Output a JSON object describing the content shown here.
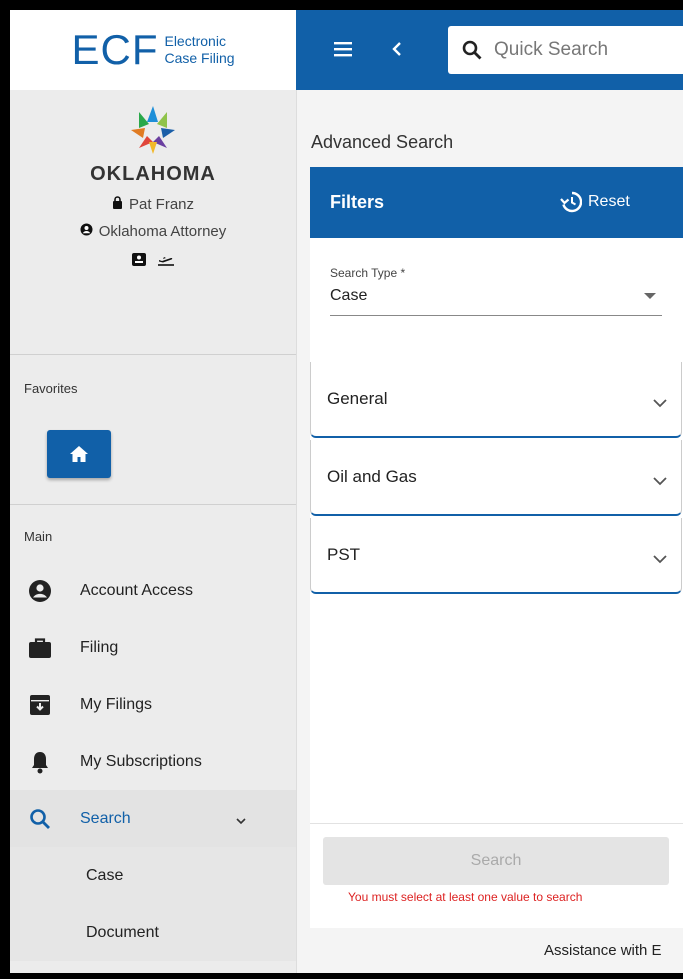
{
  "app": {
    "logo_main": "ECF",
    "logo_sub1": "Electronic",
    "logo_sub2": "Case Filing"
  },
  "profile": {
    "state": "OKLAHOMA",
    "user_name": "Pat Franz",
    "org": "Oklahoma Attorney"
  },
  "favorites": {
    "label": "Favorites"
  },
  "main_nav": {
    "label": "Main",
    "items": [
      {
        "label": "Account Access",
        "icon": "account-circle-icon"
      },
      {
        "label": "Filing",
        "icon": "briefcase-icon"
      },
      {
        "label": "My Filings",
        "icon": "archive-icon"
      },
      {
        "label": "My Subscriptions",
        "icon": "bell-icon"
      },
      {
        "label": "Search",
        "icon": "search-icon"
      }
    ],
    "search_sub": [
      "Case",
      "Document"
    ]
  },
  "topbar": {
    "quick_search_placeholder": "Quick Search"
  },
  "page": {
    "title": "Advanced Search"
  },
  "filters": {
    "title": "Filters",
    "reset_label": "Reset",
    "search_type_label": "Search Type *",
    "search_type_value": "Case",
    "sections": [
      "General",
      "Oil and Gas",
      "PST"
    ]
  },
  "actions": {
    "search_label": "Search",
    "error": "You must select at least one value to search"
  },
  "footer": {
    "assist": "Assistance with E"
  },
  "colors": {
    "brand": "#1160a8",
    "error": "#d22222"
  }
}
